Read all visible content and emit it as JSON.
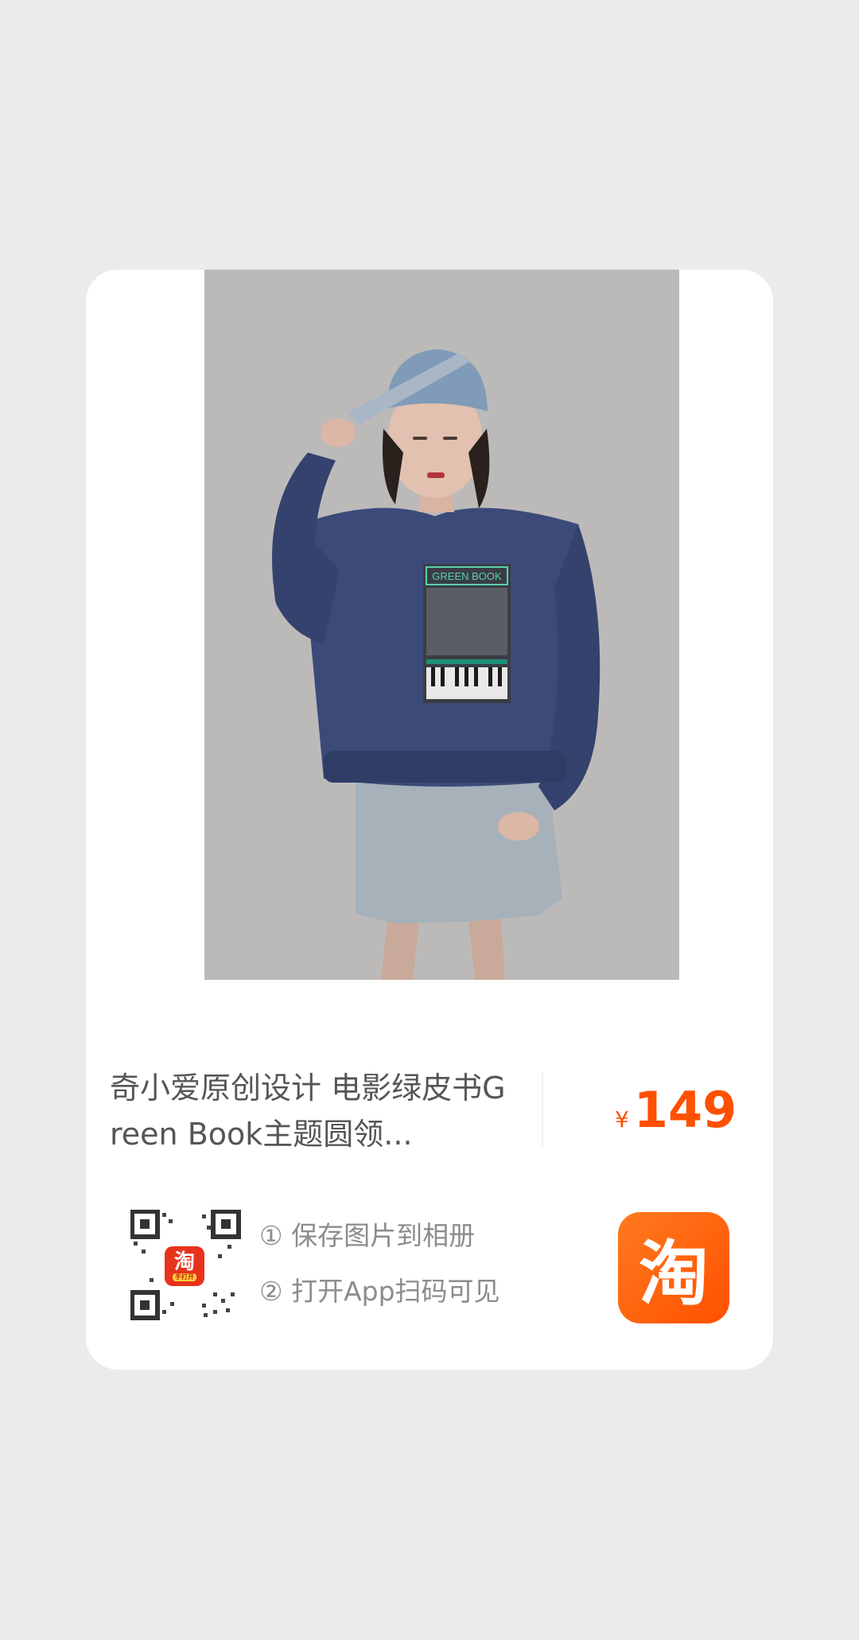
{
  "product": {
    "title": "奇小爱原创设计 电影绿皮书Green Book主题圆领...",
    "price_currency": "¥",
    "price_value": "149",
    "print_text": "GREEN BOOK"
  },
  "share": {
    "step1": "① 保存图片到相册",
    "step2": "② 打开App扫码可见",
    "qr_badge_char": "淘",
    "qr_badge_sub": "手打开",
    "app_icon_char": "淘"
  },
  "colors": {
    "background": "#ebebeb",
    "card": "#ffffff",
    "price": "#ff5000",
    "brand": "#ff5000",
    "text": "#555555",
    "muted": "#8c8c8c"
  },
  "icons": {
    "qr": "qr-code-icon",
    "app": "taobao-app-icon"
  }
}
